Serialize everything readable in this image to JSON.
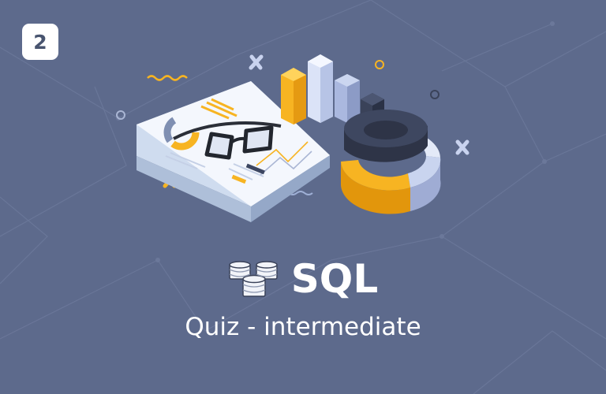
{
  "badge": {
    "number": "2"
  },
  "title": "SQL",
  "subtitle": "Quiz - intermediate",
  "icons": {
    "title_icon": "database-stack-icon",
    "illustration": "data-report-illustration"
  },
  "colors": {
    "background": "#5d6a8c",
    "accent_yellow": "#f7b422",
    "text": "#ffffff",
    "badge_text": "#48546f"
  }
}
